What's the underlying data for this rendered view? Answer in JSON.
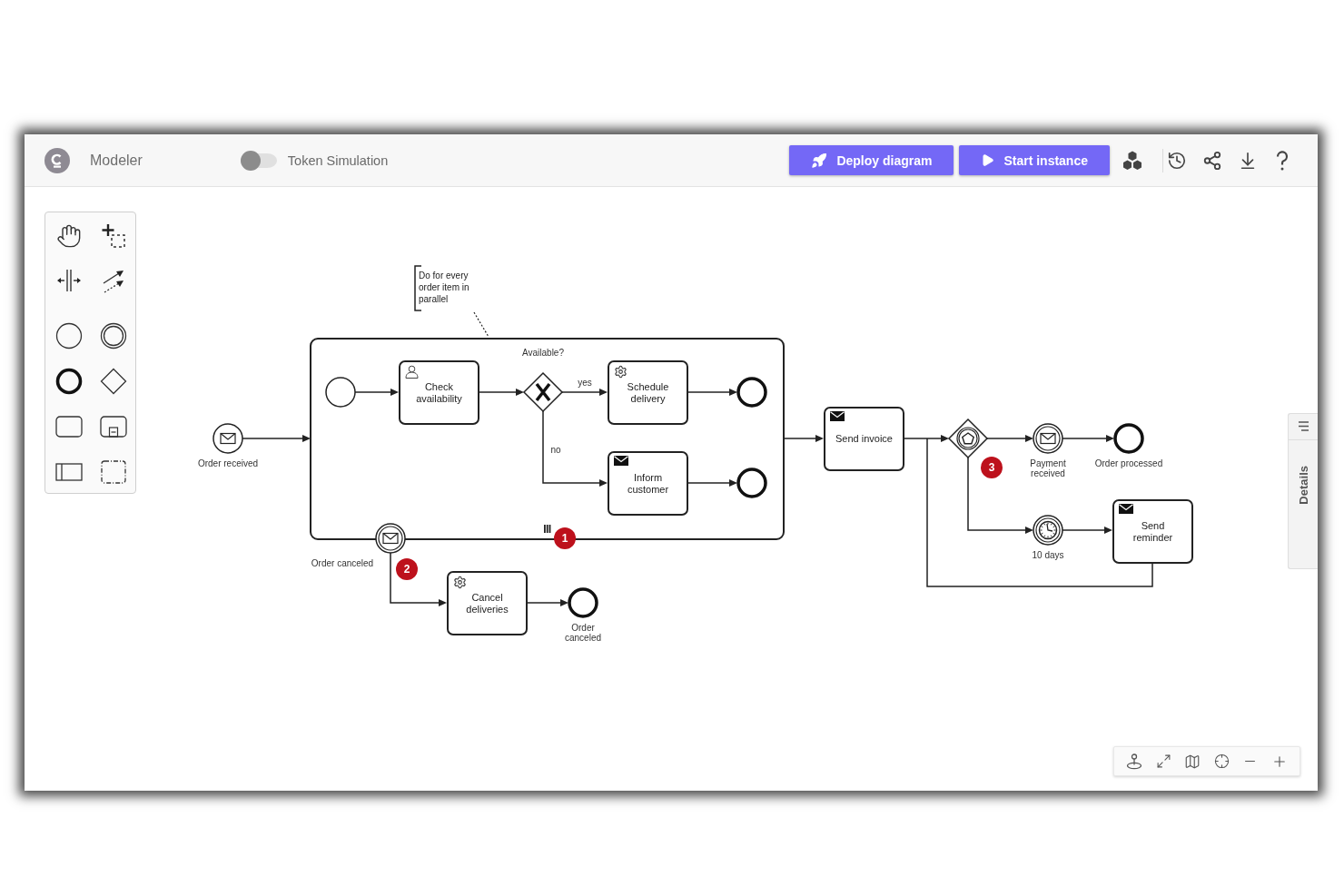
{
  "header": {
    "app_name": "Modeler",
    "token_simulation": {
      "label": "Token Simulation",
      "on": false
    },
    "buttons": [
      {
        "label": "Deploy diagram",
        "kind": "deploy"
      },
      {
        "label": "Start instance",
        "kind": "start"
      }
    ]
  },
  "diagram": {
    "annotation": "Do for every order item in parallel",
    "subprocess": {
      "parallel_multi_instance": true
    },
    "tasks": [
      {
        "label": "Check availability",
        "kind": "user"
      },
      {
        "label": "Schedule delivery",
        "kind": "service"
      },
      {
        "label": "Inform customer",
        "kind": "send"
      },
      {
        "label": "Send invoice",
        "kind": "send"
      },
      {
        "label": "Send reminder",
        "kind": "send"
      },
      {
        "label": "Cancel deliveries",
        "kind": "service"
      }
    ],
    "events": [
      {
        "label": "Order received",
        "kind": "message-start"
      },
      {
        "kind": "start"
      },
      {
        "kind": "end"
      },
      {
        "kind": "end"
      },
      {
        "label": "Payment received",
        "kind": "message-catch"
      },
      {
        "label": "Order processed",
        "kind": "end"
      },
      {
        "label": "10 days",
        "kind": "timer"
      },
      {
        "label": "Order canceled",
        "kind": "message-boundary"
      },
      {
        "label": "Order canceled",
        "kind": "end"
      }
    ],
    "gateways": [
      {
        "kind": "exclusive",
        "label": "Available?",
        "branch_labels": [
          "yes",
          "no"
        ]
      },
      {
        "kind": "event-based"
      }
    ],
    "badges": [
      "1",
      "2",
      "3"
    ]
  },
  "details_panel": {
    "label": "Details"
  }
}
